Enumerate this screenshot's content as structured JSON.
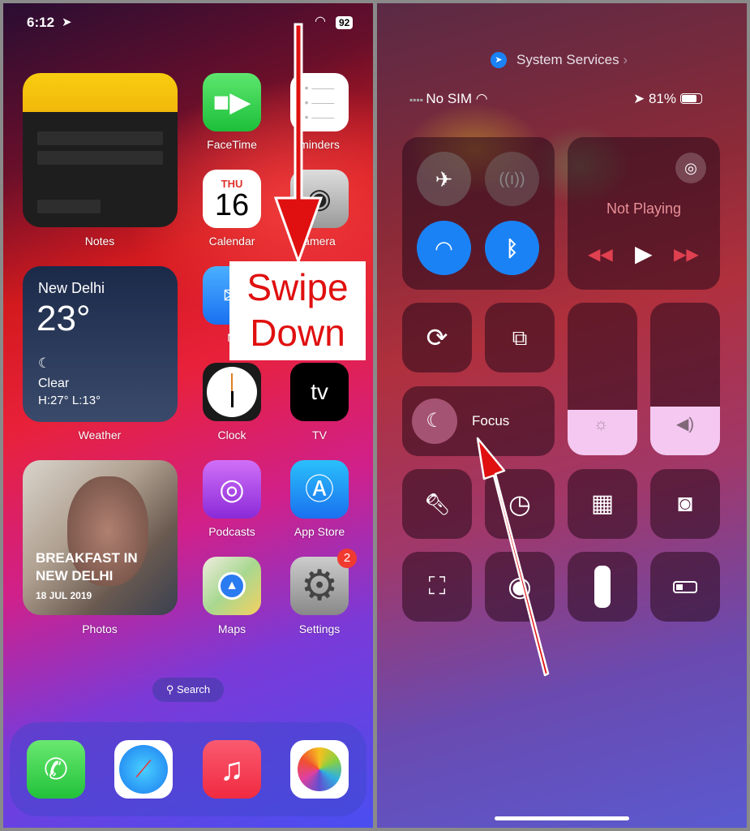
{
  "home": {
    "status": {
      "time": "6:12",
      "battery": "92"
    },
    "notes_widget": {
      "label": "Notes"
    },
    "weather": {
      "city": "New Delhi",
      "temp": "23°",
      "condition": "Clear",
      "range": "H:27° L:13°",
      "label": "Weather"
    },
    "photos": {
      "title_line1": "BREAKFAST IN",
      "title_line2": "NEW DELHI",
      "date": "18 JUL 2019",
      "label": "Photos"
    },
    "apps": {
      "facetime": "FaceTime",
      "reminders": "minders",
      "calendar": "Calendar",
      "calendar_day": "THU",
      "calendar_date": "16",
      "camera": "amera",
      "mail": "M",
      "clock": "Clock",
      "tv": "TV",
      "tv_logo": "tv",
      "podcasts": "Podcasts",
      "appstore": "App Store",
      "maps": "Maps",
      "settings": "Settings",
      "settings_badge": "2"
    },
    "search": "Search",
    "annotation": {
      "line1": "Swipe",
      "line2": "Down"
    }
  },
  "control_center": {
    "location_banner": "System Services",
    "status": {
      "carrier": "No SIM",
      "battery": "81%"
    },
    "media": {
      "title": "Not Playing"
    },
    "focus": {
      "label": "Focus"
    },
    "brightness_level": 0.3,
    "volume_level": 0.32
  },
  "colors": {
    "annotation_red": "#e01010",
    "toggle_blue": "#1a82f5"
  }
}
